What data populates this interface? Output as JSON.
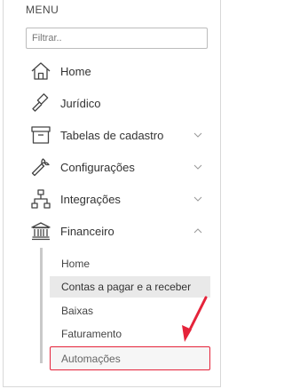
{
  "menu": {
    "title": "MENU"
  },
  "search": {
    "placeholder": "Filtrar.."
  },
  "nav": {
    "items": [
      {
        "label": "Home",
        "icon": "house-icon"
      },
      {
        "label": "Jurídico",
        "icon": "gavel-icon"
      },
      {
        "label": "Tabelas de cadastro",
        "icon": "archive-box-icon",
        "expanded": false
      },
      {
        "label": "Configurações",
        "icon": "wrench-icon",
        "expanded": false
      },
      {
        "label": "Integrações",
        "icon": "network-icon",
        "expanded": false
      },
      {
        "label": "Financeiro",
        "icon": "bank-icon",
        "expanded": true
      }
    ]
  },
  "financeiro": {
    "subitems": [
      {
        "label": "Home",
        "state": "normal"
      },
      {
        "label": "Contas a pagar e a receber",
        "state": "active"
      },
      {
        "label": "Baixas",
        "state": "normal"
      },
      {
        "label": "Faturamento",
        "state": "normal"
      },
      {
        "label": "Automações",
        "state": "highlighted"
      }
    ]
  },
  "colors": {
    "highlight_border": "#e5233a",
    "active_background": "#e9e9e9",
    "annotation_arrow": "#e5233a"
  }
}
